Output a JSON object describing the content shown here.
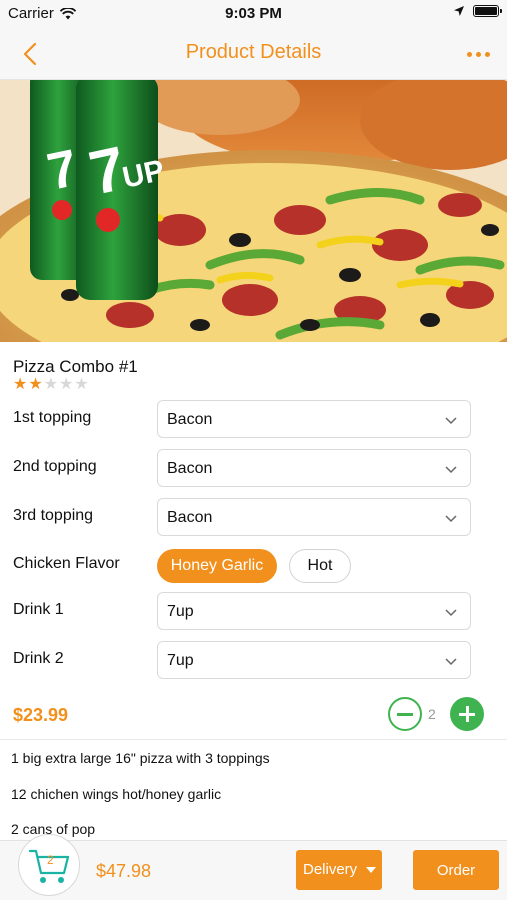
{
  "status_bar": {
    "carrier": "Carrier",
    "time": "9:03 PM",
    "icons": [
      "wifi-icon",
      "location-arrow-icon",
      "battery-icon"
    ]
  },
  "nav": {
    "title": "Product Details",
    "back_icon": "chevron-left-icon",
    "more_icon": "more-dots-icon"
  },
  "hero": {
    "image": "pizza-and-7up-cans-photo"
  },
  "product": {
    "name": "Pizza Combo #1",
    "rating": 2,
    "rating_max": 5
  },
  "options": {
    "topping1": {
      "label": "1st topping",
      "value": "Bacon"
    },
    "topping2": {
      "label": "2nd topping",
      "value": "Bacon"
    },
    "topping3": {
      "label": "3rd topping",
      "value": "Bacon"
    },
    "chicken_flavor": {
      "label": "Chicken Flavor",
      "choices": [
        "Honey Garlic",
        "Hot"
      ],
      "selected": "Honey Garlic"
    },
    "drink1": {
      "label": "Drink 1",
      "value": "7up"
    },
    "drink2": {
      "label": "Drink 2",
      "value": "7up"
    }
  },
  "pricing": {
    "unit_price": "$23.99",
    "quantity": "2"
  },
  "description": [
    "1 big extra large 16\" pizza with 3 toppings",
    "12 chichen wings hot/honey garlic",
    "2 cans of pop"
  ],
  "bottom_bar": {
    "cart_count": "2",
    "total": "$47.98",
    "delivery_label": "Delivery",
    "order_label": "Order"
  },
  "colors": {
    "accent": "#f2901d",
    "green": "#3fb34f",
    "status_bar_bg": "#f7f7f7"
  }
}
